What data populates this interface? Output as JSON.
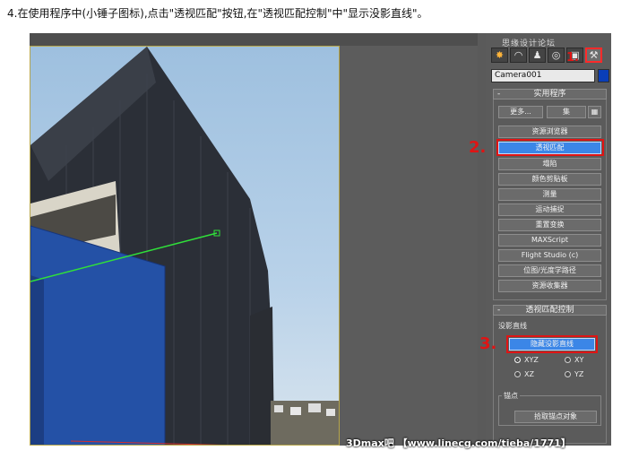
{
  "caption": "4.在使用程序中(小锤子图标),点击\"透视匹配\"按钮,在\"透视匹配控制\"中\"显示没影直线\"。",
  "panel": {
    "title": "思缘设计论坛",
    "object_name": "Camera001",
    "tabs": [
      {
        "name": "create",
        "glyph": "✸"
      },
      {
        "name": "modify",
        "glyph": "◠"
      },
      {
        "name": "hierarchy",
        "glyph": "♟"
      },
      {
        "name": "motion",
        "glyph": "◎"
      },
      {
        "name": "display",
        "glyph": "▣"
      },
      {
        "name": "utilities",
        "glyph": "⚒"
      }
    ],
    "tab_marker": "1.",
    "utilities_rollout": {
      "title": "实用程序",
      "more": "更多...",
      "sets": "集",
      "items": [
        "资源浏览器",
        "透视匹配",
        "塌陷",
        "颜色剪贴板",
        "测量",
        "运动捕捉",
        "重置变换",
        "MAXScript",
        "Flight Studio (c)",
        "位图/光度学路径",
        "资源收集器"
      ]
    },
    "marker_2": "2.",
    "pm_rollout": {
      "title": "透视匹配控制",
      "vanish_label": "没影直线",
      "toggle_button": "隐藏没影直线",
      "options": [
        "XYZ",
        "XY",
        "XZ",
        "YZ"
      ],
      "anchor_label": "锚点",
      "pick_button": "拾取锚点对象"
    },
    "marker_3": "3."
  },
  "watermark": "3Dmax吧 【www.linecg.com/tieba/1771】"
}
